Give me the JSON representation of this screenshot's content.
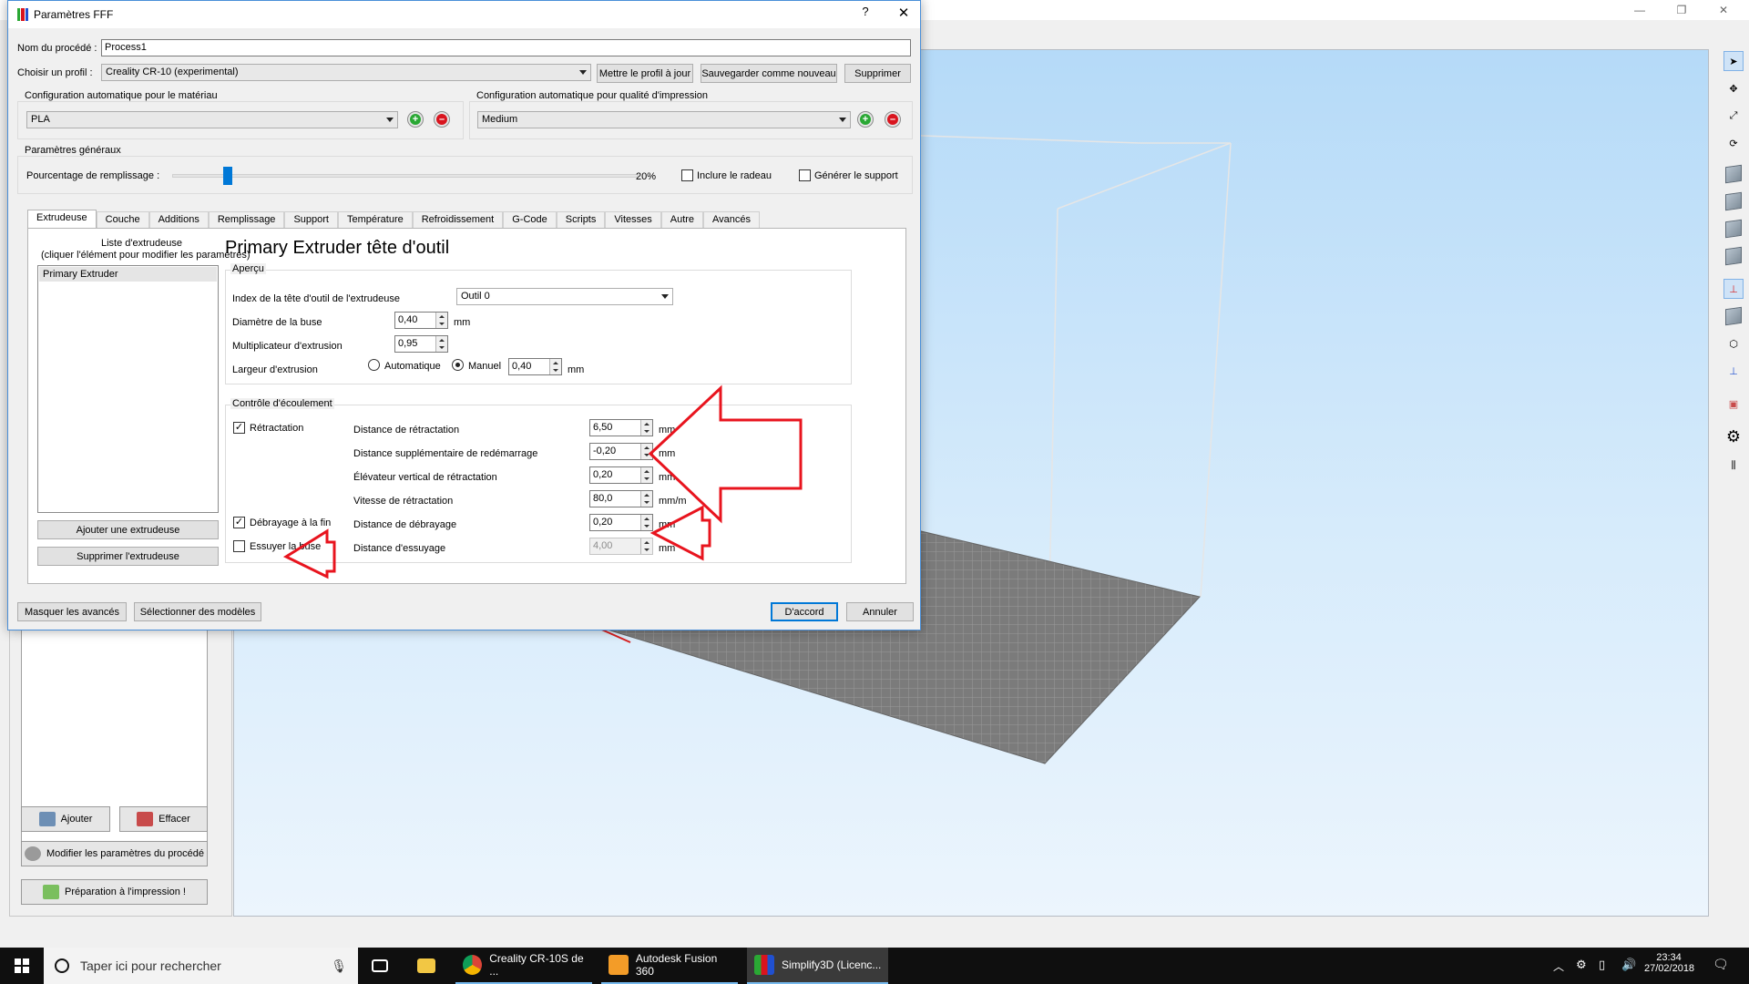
{
  "dialog": {
    "title": "Paramètres FFF",
    "help": "?",
    "close": "✕",
    "process_name_label": "Nom du procédé :",
    "process_name_value": "Process1",
    "profile_label": "Choisir un profil :",
    "profile_value": "Creality CR-10 (experimental)",
    "update_profile_button": "Mettre le profil à jour",
    "save_as_new_button": "Sauvegarder comme nouveau",
    "delete_button": "Supprimer",
    "material_config_label": "Configuration automatique pour le matériau",
    "material_value": "PLA",
    "quality_config_label": "Configuration automatique pour qualité d'impression",
    "quality_value": "Medium",
    "general_settings_label": "Paramètres généraux",
    "infill_label": "Pourcentage de remplissage :",
    "infill_value": "20%",
    "infill_fraction": 0.2,
    "include_raft_label": "Inclure le radeau",
    "generate_support_label": "Générer le support",
    "tabs": [
      "Extrudeuse",
      "Couche",
      "Additions",
      "Remplissage",
      "Support",
      "Température",
      "Refroidissement",
      "G-Code",
      "Scripts",
      "Vitesses",
      "Autre",
      "Avancés"
    ],
    "extruder_list_label_1": "Liste d'extrudeuse",
    "extruder_list_label_2": "(cliquer l'élément pour modifier les paramètres)",
    "extruder_list_items": [
      "Primary Extruder"
    ],
    "add_extruder_button": "Ajouter une extrudeuse",
    "remove_extruder_button": "Supprimer l'extrudeuse",
    "extruder_heading": "Primary Extruder tête d'outil",
    "overview_group": "Aperçu",
    "tool_index_label": "Index de la tête d'outil de l'extrudeuse",
    "tool_index_value": "Outil 0",
    "nozzle_diameter_label": "Diamètre de la buse",
    "nozzle_diameter_value": "0,40",
    "extrusion_multiplier_label": "Multiplicateur d'extrusion",
    "extrusion_multiplier_value": "0,95",
    "extrusion_width_label": "Largeur d'extrusion",
    "auto_label": "Automatique",
    "manual_label": "Manuel",
    "extrusion_width_value": "0,40",
    "unit_mm": "mm",
    "flow_group": "Contrôle d'écoulement",
    "retraction_label": "Rétractation",
    "retraction_distance_label": "Distance de rétractation",
    "retraction_distance_value": "6,50",
    "extra_restart_label": "Distance supplémentaire de redémarrage",
    "extra_restart_value": "-0,20",
    "vertical_lift_label": "Élévateur vertical de rétractation",
    "vertical_lift_value": "0,20",
    "retraction_speed_label": "Vitesse de rétractation",
    "retraction_speed_value": "80,0",
    "retraction_speed_unit": "mm/m",
    "coast_label": "Débrayage à la fin",
    "coast_distance_label": "Distance de débrayage",
    "coast_distance_value": "0,20",
    "wipe_label": "Essuyer la buse",
    "wipe_distance_label": "Distance d'essuyage",
    "wipe_distance_value": "4,00",
    "hide_advanced_button": "Masquer les avancés",
    "select_models_button": "Sélectionner des modèles",
    "ok_button": "D'accord",
    "cancel_button": "Annuler"
  },
  "left_panel": {
    "add_button": "Ajouter",
    "clear_button": "Effacer",
    "edit_process_button": "Modifier les paramètres du procédé",
    "prepare_button": "Préparation à l'impression !"
  },
  "taskbar": {
    "search_placeholder": "Taper ici pour rechercher",
    "apps": [
      {
        "label": "Creality CR-10S de ..."
      },
      {
        "label": "Autodesk Fusion 360"
      },
      {
        "label": "Simplify3D (Licenc..."
      }
    ],
    "time": "23:34",
    "date": "27/02/2018"
  },
  "colors": {
    "accent": "#0078d7",
    "annotation_red": "#e8141e",
    "viewport_top": "#b5daf8",
    "bed": "#7b7b7b"
  }
}
